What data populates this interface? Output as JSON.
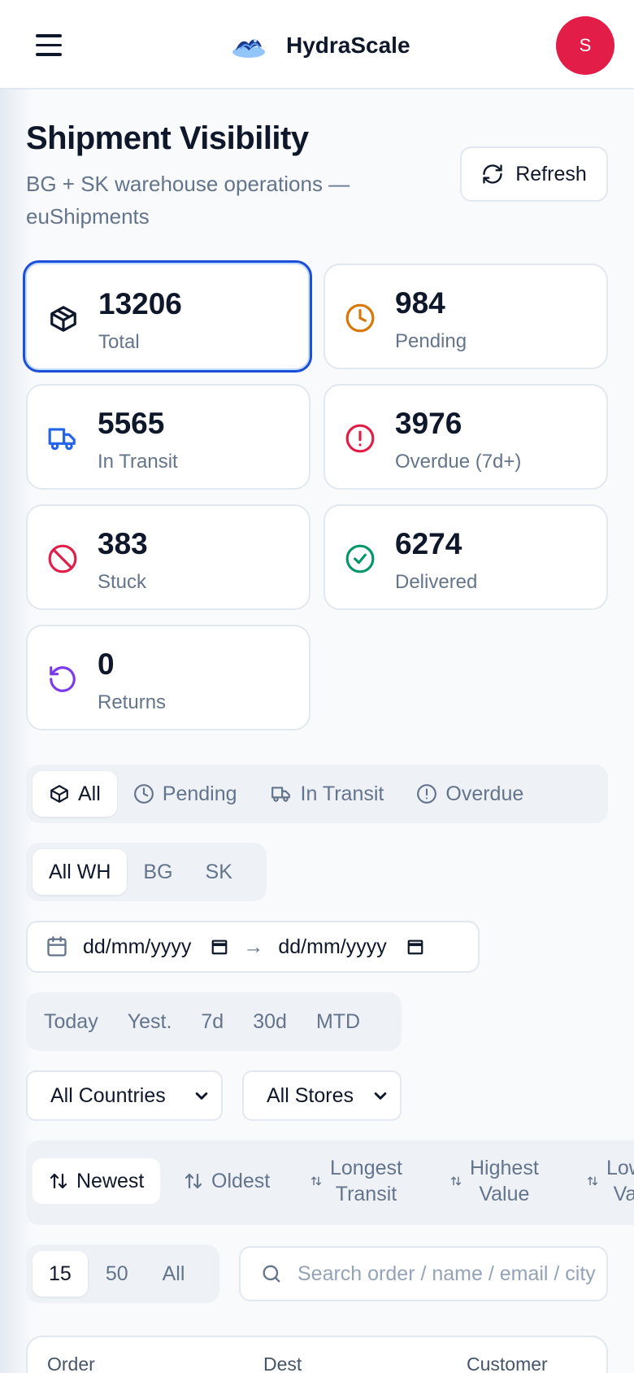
{
  "header": {
    "brand": "HydraScale",
    "avatar_initial": "S",
    "avatar_color": "#e11d48"
  },
  "page": {
    "title": "Shipment Visibility",
    "subtitle": "BG + SK warehouse operations — euShipments",
    "refresh_label": "Refresh"
  },
  "stats": [
    {
      "value": "13206",
      "label": "Total",
      "icon": "box-icon",
      "color": "#0f172a",
      "active": true
    },
    {
      "value": "984",
      "label": "Pending",
      "icon": "clock-icon",
      "color": "#d97706"
    },
    {
      "value": "5565",
      "label": "In Transit",
      "icon": "truck-icon",
      "color": "#2563eb"
    },
    {
      "value": "3976",
      "label": "Overdue (7d+)",
      "icon": "alert-circle-icon",
      "color": "#e11d48"
    },
    {
      "value": "383",
      "label": "Stuck",
      "icon": "ban-icon",
      "color": "#e11d48"
    },
    {
      "value": "6274",
      "label": "Delivered",
      "icon": "check-circle-icon",
      "color": "#059669"
    },
    {
      "value": "0",
      "label": "Returns",
      "icon": "rotate-ccw-icon",
      "color": "#7c3aed"
    }
  ],
  "status_tabs": [
    {
      "label": "All",
      "icon": "box-icon",
      "selected": true
    },
    {
      "label": "Pending",
      "icon": "clock-icon"
    },
    {
      "label": "In Transit",
      "icon": "truck-icon"
    },
    {
      "label": "Overdue",
      "icon": "alert-circle-icon"
    }
  ],
  "warehouse_tabs": [
    {
      "label": "All WH",
      "selected": true
    },
    {
      "label": "BG"
    },
    {
      "label": "SK"
    }
  ],
  "date_range": {
    "from_placeholder": "dd/mm/yyyy",
    "to_placeholder": "dd/mm/yyyy",
    "arrow": "→"
  },
  "date_presets": [
    "Today",
    "Yest.",
    "7d",
    "30d",
    "MTD"
  ],
  "filters": {
    "country": "All Countries",
    "store": "All Stores"
  },
  "sort_options": [
    {
      "line1": "Newest",
      "selected": true
    },
    {
      "line1": "Oldest"
    },
    {
      "line1": "Longest",
      "line2": "Transit"
    },
    {
      "line1": "Highest",
      "line2": "Value"
    },
    {
      "line1": "Lowest",
      "line2": "Value"
    }
  ],
  "page_size": [
    {
      "label": "15",
      "selected": true
    },
    {
      "label": "50"
    },
    {
      "label": "All"
    }
  ],
  "search": {
    "placeholder": "Search order / name / email / city"
  },
  "table": {
    "columns": [
      "Order",
      "Dest",
      "Customer"
    ]
  }
}
